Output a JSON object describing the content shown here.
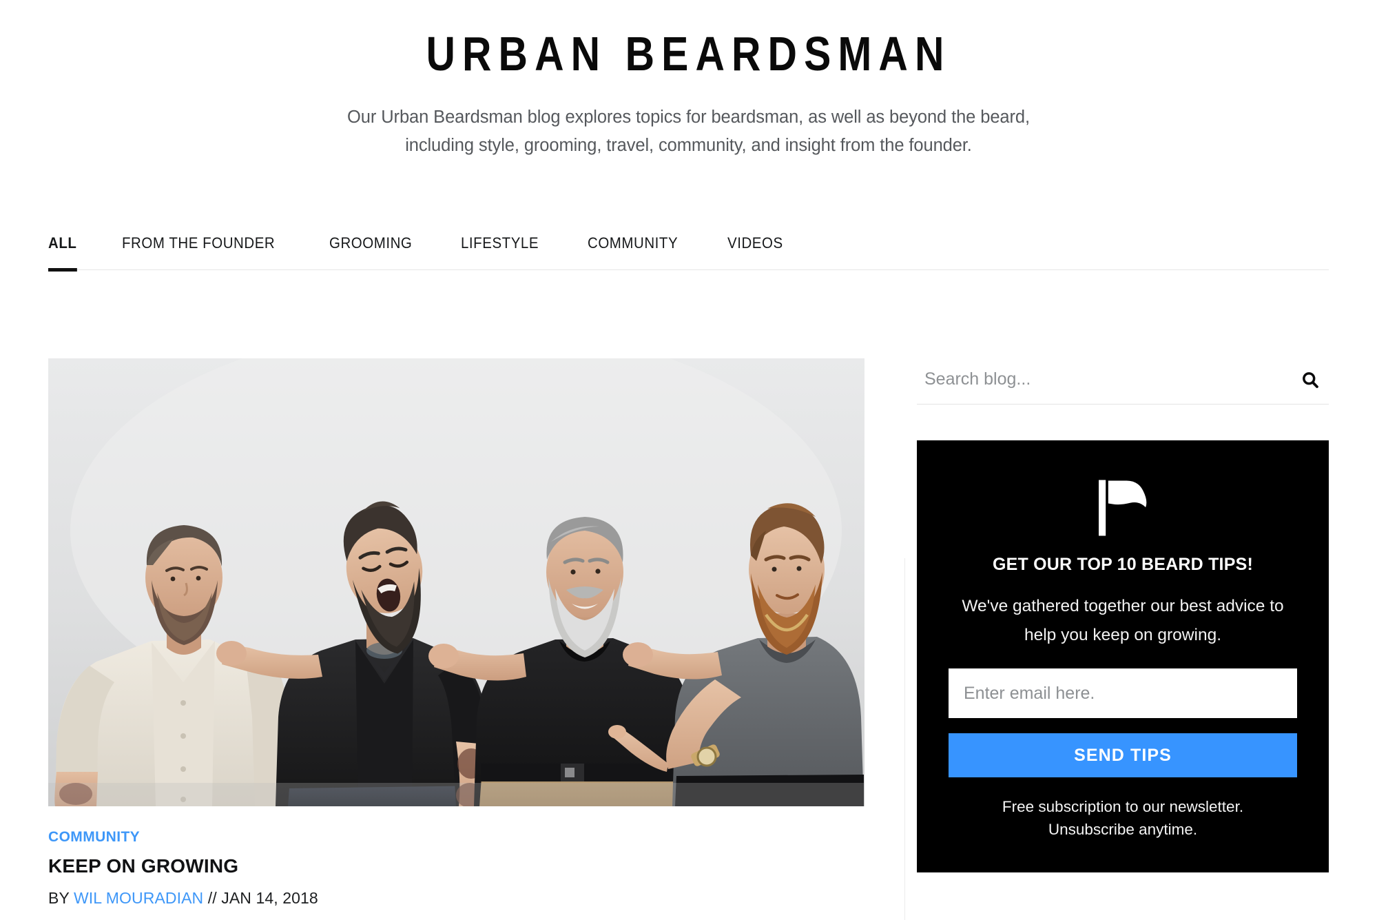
{
  "header": {
    "title": "URBAN BEARDSMAN",
    "tagline_line1": "Our Urban Beardsman blog explores topics for beardsman, as well as beyond the beard,",
    "tagline_line2": "including style, grooming, travel, community, and insight from the founder."
  },
  "nav": {
    "tabs": [
      {
        "label": "ALL",
        "active": true
      },
      {
        "label": "FROM THE FOUNDER",
        "active": false
      },
      {
        "label": "GROOMING",
        "active": false
      },
      {
        "label": "LIFESTYLE",
        "active": false
      },
      {
        "label": "COMMUNITY",
        "active": false
      },
      {
        "label": "VIDEOS",
        "active": false
      }
    ]
  },
  "article": {
    "photo_alt": "Four bearded men standing arm-in-arm against a light gray studio backdrop",
    "category": "COMMUNITY",
    "title": "KEEP ON GROWING",
    "byline_prefix": "BY",
    "author": "WIL MOURADIAN",
    "byline_separator": "//",
    "date": "JAN 14, 2018"
  },
  "search": {
    "placeholder": "Search blog...",
    "value": "",
    "icon": "search-icon"
  },
  "newsletter": {
    "icon": "flag-icon",
    "heading": "GET OUR TOP 10 BEARD TIPS!",
    "subtext_line1": "We've gathered together our best advice to",
    "subtext_line2": "help you keep on growing.",
    "email_placeholder": "Enter email here.",
    "email_value": "",
    "submit_label": "SEND TIPS",
    "fineprint_line1": "Free subscription to our newsletter.",
    "fineprint_line2": "Unsubscribe anytime."
  },
  "colors": {
    "accent_blue": "#3e97f8",
    "button_blue": "#3794ff",
    "ink": "#111214",
    "panel_black": "#000000",
    "rule": "#e6e6e6"
  }
}
